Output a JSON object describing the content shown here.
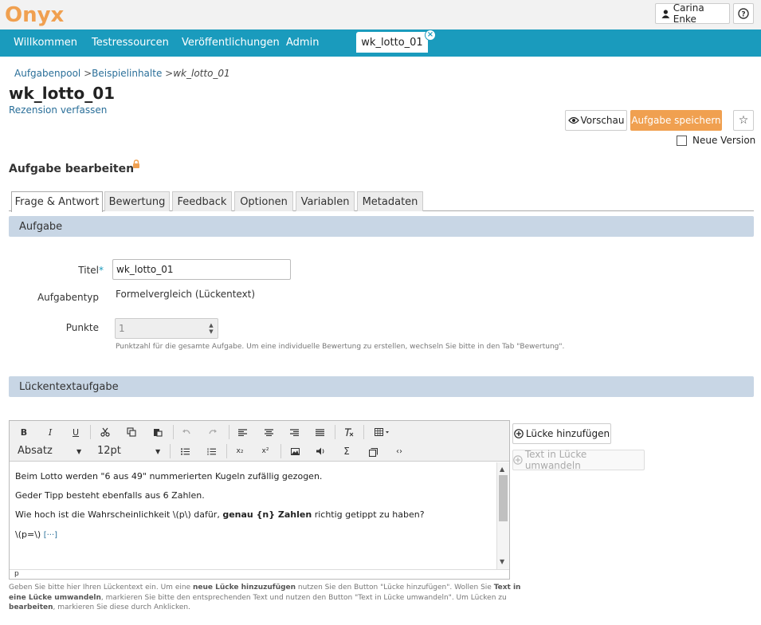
{
  "header": {
    "logo_text": "Onyx",
    "user_name": "Carina Enke",
    "help_icon": "help-circle-icon",
    "user_icon": "user-icon"
  },
  "nav": {
    "items": [
      "Willkommen",
      "Testressourcen",
      "Veröffentlichungen",
      "Admin"
    ],
    "open_tab": "wk_lotto_01",
    "close_glyph": "×"
  },
  "breadcrumb": {
    "items": [
      "Aufgabenpool",
      "Beispielinhalte"
    ],
    "separator": ">",
    "current": "wk_lotto_01"
  },
  "page": {
    "title": "wk_lotto_01",
    "review_link": "Rezension verfassen",
    "preview_label": "Vorschau",
    "save_label": "Aufgabe speichern",
    "new_version_label": "Neue Version",
    "star_glyph": "☆",
    "section_title": "Aufgabe bearbeiten"
  },
  "tabs": [
    "Frage & Antwort",
    "Bewertung",
    "Feedback",
    "Optionen",
    "Variablen",
    "Metadaten"
  ],
  "aufgabe_panel": {
    "heading": "Aufgabe",
    "title_label": "Titel",
    "required_mark": "*",
    "title_value": "wk_lotto_01",
    "type_label": "Aufgabentyp",
    "type_value": "Formelvergleich (Lückentext)",
    "points_label": "Punkte",
    "points_value": "1",
    "points_help": "Punktzahl für die gesamte Aufgabe. Um eine individuelle Bewertung zu erstellen, wechseln Sie bitte in den Tab \"Bewertung\"."
  },
  "cloze_panel": {
    "heading": "Lückentextaufgabe",
    "format_select": "Absatz",
    "size_select": "12pt",
    "paragraphs": [
      "Beim Lotto werden \"6 aus 49\" nummerierten Kugeln zufällig gezogen.",
      "Geder Tipp besteht ebenfalls aus 6 Zahlen."
    ],
    "question_pre": "Wie hoch ist die Wahrscheinlichkeit \\(p\\) dafür, ",
    "question_bold": "genau {n} Zahlen",
    "question_post": " richtig getippt zu haben?",
    "formula_text": "\\(p=\\)",
    "gap_marker": "[···]",
    "status_path": "p",
    "add_gap_label": "Lücke hinzufügen",
    "convert_label": "Text in Lücke umwandeln",
    "help_1": "Geben Sie bitte hier Ihren Lückentext ein. Um eine ",
    "help_b1": "neue Lücke hinzuzufügen",
    "help_2": " nutzen Sie den Button \"Lücke hinzufügen\". Wollen Sie ",
    "help_b2": "Text in eine Lücke umwandeln",
    "help_3": ", markieren Sie bitte den entsprechenden Text und nutzen den Button \"Text in Lücke umwandeln\". Um Lücken zu ",
    "help_b3": "bearbeiten",
    "help_4": ", markieren Sie diese durch Anklicken."
  },
  "toolbar_glyphs": {
    "bold": "B",
    "italic": "I",
    "underline": "U",
    "align_justify": "≡",
    "clear_format": "T̲ₓ",
    "subscript": "x₂",
    "superscript": "x²",
    "sigma": "Σ",
    "code": "‹›",
    "bullet_list": "⁝≡",
    "number_list": "⅟≡"
  },
  "colors": {
    "nav_bg": "#1a9bbd",
    "save_bg": "#f0a050",
    "panel_head_bg": "#c8d6e5",
    "link": "#2a6f99"
  }
}
